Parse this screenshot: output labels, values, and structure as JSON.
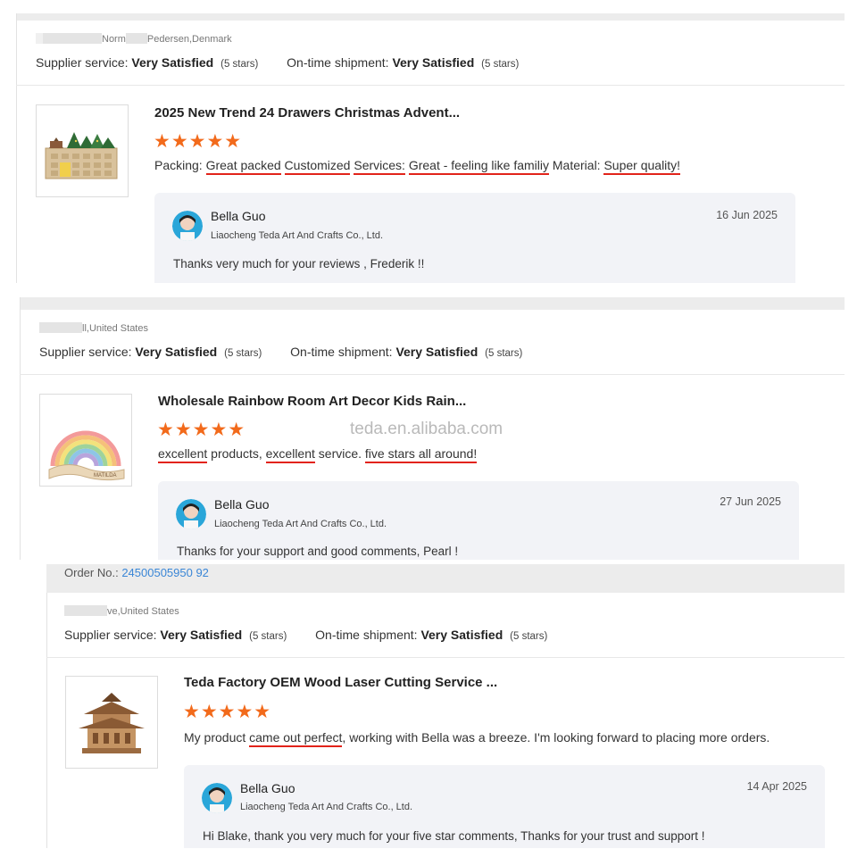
{
  "reviews": [
    {
      "location": "Pedersen,Denmark",
      "location_partial": "Norm",
      "supplier_service_label": "Supplier service:",
      "supplier_service_value": "Very Satisfied",
      "supplier_service_note": "(5 stars)",
      "shipment_label": "On-time shipment:",
      "shipment_value": "Very Satisfied",
      "shipment_note": "(5 stars)",
      "product_title": "2025 New Trend 24 Drawers Christmas Advent...",
      "stars": "★★★★★",
      "rating": 5,
      "review_parts": [
        "Packing:",
        "Great packed",
        "Customized",
        "Services:",
        "Great - feeling like familiy",
        "Material:",
        "Super quality!"
      ],
      "reply": {
        "name": "Bella Guo",
        "company": "Liaocheng Teda Art And Crafts Co., Ltd.",
        "date": "16 Jun 2025",
        "message": "Thanks very much for your reviews , Frederik !!"
      }
    },
    {
      "location": "ll,United States",
      "supplier_service_label": "Supplier service:",
      "supplier_service_value": "Very Satisfied",
      "supplier_service_note": "(5 stars)",
      "shipment_label": "On-time shipment:",
      "shipment_value": "Very Satisfied",
      "shipment_note": "(5 stars)",
      "product_title": "Wholesale Rainbow Room Art Decor Kids Rain...",
      "stars": "★★★★★",
      "rating": 5,
      "watermark": "teda.en.alibaba.com",
      "review_parts": [
        "excellent",
        " products, ",
        "excellent",
        " service. ",
        "five stars all around!"
      ],
      "thumb_text": "MATILDA",
      "reply": {
        "name": "Bella Guo",
        "company": "Liaocheng Teda Art And Crafts Co., Ltd.",
        "date": "27 Jun 2025",
        "message": "Thanks for  your support and good comments, Pearl !"
      }
    },
    {
      "order_label": "Order No.:",
      "order_number": "24500505950 92",
      "location": "ve,United States",
      "supplier_service_label": "Supplier service:",
      "supplier_service_value": "Very Satisfied",
      "supplier_service_note": "(5 stars)",
      "shipment_label": "On-time shipment:",
      "shipment_value": "Very Satisfied",
      "shipment_note": "(5 stars)",
      "product_title": "Teda Factory OEM Wood Laser Cutting Service ...",
      "stars": "★★★★★",
      "rating": 5,
      "review_parts": [
        "My product ",
        "came out perfect",
        ", working with Bella was a breeze. I'm looking forward to placing more orders."
      ],
      "reply": {
        "name": "Bella Guo",
        "company": "Liaocheng Teda Art And Crafts Co., Ltd.",
        "date": "14 Apr 2025",
        "message": "Hi Blake,  thank you very much for your five star comments, Thanks for your trust and support !"
      }
    }
  ],
  "colors": {
    "star": "#f26a1b",
    "underline": "#e2231a",
    "reply_bg": "#f2f3f7",
    "order_number": "#3a86d6"
  },
  "icons": {
    "star": "star-icon",
    "avatar": "avatar-icon"
  }
}
